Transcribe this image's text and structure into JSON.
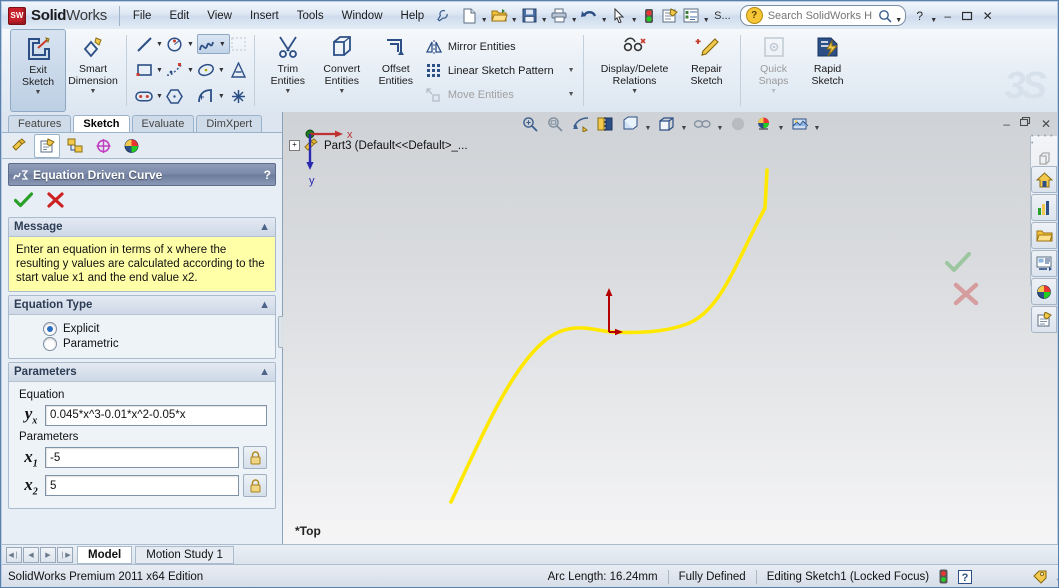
{
  "app": {
    "brand_bold": "Solid",
    "brand_light": "Works",
    "logo_text": "SW",
    "edition": "SolidWorks Premium 2011 x64 Edition"
  },
  "menubar": {
    "items": [
      "File",
      "Edit",
      "View",
      "Insert",
      "Tools",
      "Window",
      "Help"
    ],
    "pin_icon": "pushpin-icon"
  },
  "quick_access": {
    "icons": [
      {
        "name": "new-document-icon",
        "has_arrow": true
      },
      {
        "name": "open-document-icon",
        "has_arrow": true
      },
      {
        "name": "save-icon",
        "has_arrow": true
      },
      {
        "name": "print-icon",
        "has_arrow": true
      },
      {
        "name": "undo-icon",
        "has_arrow": true
      },
      {
        "name": "select-cursor-icon",
        "has_arrow": true
      },
      {
        "name": "rebuild-traffic-light-icon",
        "has_arrow": false
      },
      {
        "name": "options-icon",
        "has_arrow": false
      },
      {
        "name": "customize-list-icon",
        "has_arrow": true
      }
    ],
    "overflow_label": "S..."
  },
  "search": {
    "placeholder": "Search SolidWorks H",
    "icon": "search-help-icon",
    "dropdown_icon": "chevron-down-icon"
  },
  "window_buttons": {
    "help": "?",
    "help_arrow": "▾",
    "minimize": "–",
    "restore": "❑",
    "close": "✕"
  },
  "ribbon": {
    "commands": [
      {
        "label_line1": "Exit",
        "label_line2": "Sketch",
        "icon": "exit-sketch-icon",
        "selected": true,
        "has_dropdown": true
      },
      {
        "label_line1": "Smart",
        "label_line2": "Dimension",
        "icon": "smart-dimension-icon",
        "selected": false,
        "has_dropdown": true
      },
      {
        "label_line1": "Trim",
        "label_line2": "Entities",
        "icon": "trim-entities-icon",
        "selected": false,
        "has_dropdown": true
      },
      {
        "label_line1": "Convert",
        "label_line2": "Entities",
        "icon": "convert-entities-icon",
        "selected": false,
        "has_dropdown": true
      },
      {
        "label_line1": "Offset",
        "label_line2": "Entities",
        "icon": "offset-entities-icon",
        "selected": false,
        "has_dropdown": false
      },
      {
        "label_line1": "Display/Delete",
        "label_line2": "Relations",
        "icon": "display-delete-relations-icon",
        "selected": false,
        "has_dropdown": true
      },
      {
        "label_line1": "Repair",
        "label_line2": "Sketch",
        "icon": "repair-sketch-icon",
        "selected": false,
        "has_dropdown": false
      },
      {
        "label_line1": "Quick",
        "label_line2": "Snaps",
        "icon": "quick-snaps-icon",
        "selected": false,
        "has_dropdown": true,
        "disabled": true
      },
      {
        "label_line1": "Rapid",
        "label_line2": "Sketch",
        "icon": "rapid-sketch-icon",
        "selected": false,
        "has_dropdown": false
      }
    ],
    "sketch_tools": [
      {
        "name": "line-icon",
        "arrow": true,
        "highlight": false
      },
      {
        "name": "circle-icon",
        "arrow": true,
        "highlight": false
      },
      {
        "name": "spline-icon",
        "arrow": true,
        "highlight": true
      },
      {
        "name": "sketch-pattern-ghost-icon",
        "arrow": false,
        "highlight": false
      },
      {
        "name": "rectangle-icon",
        "arrow": true,
        "highlight": false
      },
      {
        "name": "spline-points-icon",
        "arrow": true,
        "highlight": false
      },
      {
        "name": "ellipse-icon",
        "arrow": true,
        "highlight": false
      },
      {
        "name": "text-icon",
        "arrow": false,
        "highlight": false
      },
      {
        "name": "slot-icon",
        "arrow": true,
        "highlight": false
      },
      {
        "name": "polygon-icon",
        "arrow": false,
        "highlight": false
      },
      {
        "name": "arc-icon",
        "arrow": true,
        "highlight": false
      },
      {
        "name": "point-icon",
        "arrow": false,
        "highlight": false
      }
    ],
    "entity_rows": [
      {
        "label": "Mirror Entities",
        "icon": "mirror-entities-icon",
        "arrow": false,
        "disabled": false
      },
      {
        "label": "Linear Sketch Pattern",
        "icon": "linear-sketch-pattern-icon",
        "arrow": true,
        "disabled": false
      },
      {
        "label": "Move Entities",
        "icon": "move-entities-icon",
        "arrow": true,
        "disabled": true
      }
    ],
    "watermark": "3S"
  },
  "command_tabs": {
    "items": [
      "Features",
      "Sketch",
      "Evaluate",
      "DimXpert"
    ],
    "active": "Sketch"
  },
  "pm_tabs": [
    {
      "name": "feature-manager-tab-icon",
      "active": false
    },
    {
      "name": "property-manager-tab-icon",
      "active": true
    },
    {
      "name": "configuration-manager-tab-icon",
      "active": false
    },
    {
      "name": "dimxpert-manager-tab-icon",
      "active": false
    },
    {
      "name": "display-manager-tab-icon",
      "active": false
    }
  ],
  "property_manager": {
    "title": "Equation Driven Curve",
    "title_icon": "equation-driven-curve-icon",
    "help_label": "?",
    "ok_icon": "accept-checkmark-icon",
    "cancel_icon": "cancel-x-icon",
    "message": {
      "header": "Message",
      "collapse_icon": "chevron-up-icon",
      "text": "Enter an equation in terms of x where the resulting y values are calculated according to the start value x1 and the end value x2."
    },
    "equation_type": {
      "header": "Equation Type",
      "collapse_icon": "chevron-up-icon",
      "options": [
        {
          "label": "Explicit",
          "selected": true
        },
        {
          "label": "Parametric",
          "selected": false
        }
      ]
    },
    "parameters": {
      "header": "Parameters",
      "collapse_icon": "chevron-up-icon",
      "equation_group_label": "Equation",
      "equation_var": "y",
      "equation_sub": "x",
      "equation_value": "0.045*x^3-0.01*x^2-0.05*x",
      "parameters_group_label": "Parameters",
      "fields": [
        {
          "var": "x",
          "sub": "1",
          "value": "-5",
          "lock_icon": "lock-icon"
        },
        {
          "var": "x",
          "sub": "2",
          "value": "5",
          "lock_icon": "lock-icon"
        }
      ]
    }
  },
  "graphics": {
    "view_toolbar": [
      {
        "name": "zoom-to-fit-icon",
        "arrow": false
      },
      {
        "name": "zoom-to-area-icon",
        "arrow": false
      },
      {
        "name": "previous-view-icon",
        "arrow": false
      },
      {
        "name": "section-view-icon",
        "arrow": false
      },
      {
        "name": "view-orientation-icon",
        "arrow": true
      },
      {
        "name": "display-style-icon",
        "arrow": true
      },
      {
        "name": "hide-show-items-icon",
        "arrow": true
      },
      {
        "name": "edit-appearance-sphere-icon",
        "arrow": false
      },
      {
        "name": "apply-scene-icon",
        "arrow": true
      },
      {
        "name": "view-settings-icon",
        "arrow": true
      }
    ],
    "tree_item": "Part3  (Default<<Default>_...",
    "tree_icon": "part-icon",
    "tree_expander": "+",
    "doc_buttons": {
      "minimize": "–",
      "restore": "❑",
      "close": "✕"
    },
    "ghost_ok_icon": "ghost-accept-checkmark-icon",
    "ghost_cancel_icon": "ghost-cancel-x-icon",
    "triad": {
      "x_label": "x",
      "y_label": "y",
      "view_label": "*Top"
    },
    "curve_color": "#ffe800",
    "origin_color": "#b40000"
  },
  "task_pane": [
    {
      "name": "solidworks-resources-home-icon"
    },
    {
      "name": "design-library-chart-icon"
    },
    {
      "name": "file-explorer-folder-icon"
    },
    {
      "name": "search-properties-icon"
    },
    {
      "name": "appearances-scenes-icon"
    },
    {
      "name": "custom-properties-icon"
    }
  ],
  "flyout_toolbar": [
    {
      "name": "extrude-boss-icon"
    },
    {
      "name": "revolve-boss-icon"
    },
    {
      "name": "extrude-cut-icon"
    },
    {
      "name": "pattern-icon"
    },
    {
      "name": "fillet-icon"
    }
  ],
  "model_tabs": {
    "nav": [
      "◀❘",
      "◀",
      "▶",
      "❘▶"
    ],
    "items": [
      {
        "label": "Model",
        "active": true
      },
      {
        "label": "Motion Study 1",
        "active": false
      }
    ]
  },
  "status_bar": {
    "edition": "SolidWorks Premium 2011 x64 Edition",
    "arc_length": "Arc Length: 16.24mm",
    "definition_state": "Fully Defined",
    "editing_state": "Editing Sketch1 (Locked Focus)",
    "rebuild_icon": "rebuild-traffic-light-icon",
    "help_icon": "context-help-icon",
    "tags_icon": "tags-icon",
    "resize_grip": "resize-grip-icon"
  }
}
